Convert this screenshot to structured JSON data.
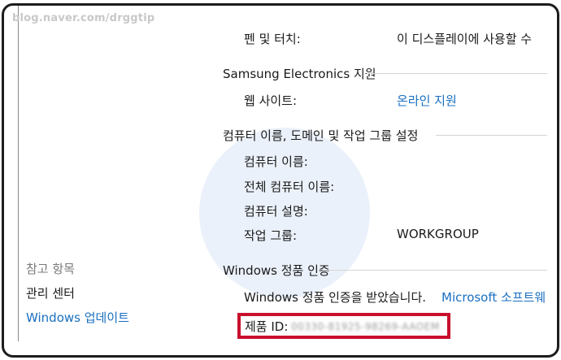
{
  "watermark": "blog.naver.com/drggtip",
  "pen_touch": {
    "label": "펜 및 터치:",
    "value": "이 디스플레이에 사용할 수"
  },
  "support": {
    "section": "Samsung Electronics 지원",
    "website_label": "웹 사이트:",
    "website_link": "온라인 지원"
  },
  "computer": {
    "section": "컴퓨터 이름, 도메인 및 작업 그룹 설정",
    "name_label": "컴퓨터 이름:",
    "full_name_label": "전체 컴퓨터 이름:",
    "description_label": "컴퓨터 설명:",
    "workgroup_label": "작업 그룹:",
    "workgroup_value": "WORKGROUP"
  },
  "see_also": {
    "title": "참고 항목",
    "items": [
      "관리 센터",
      "Windows 업데이트"
    ]
  },
  "activation": {
    "section": "Windows 정품 인증",
    "status": "Windows 정품 인증을 받았습니다.",
    "link": "Microsoft 소프트웨",
    "product_id_label": "제품 ID:",
    "product_id_value": "00330-81925-98269-AAOEM"
  },
  "colors": {
    "link": "#1a6fc0",
    "highlight": "#c8102e"
  }
}
